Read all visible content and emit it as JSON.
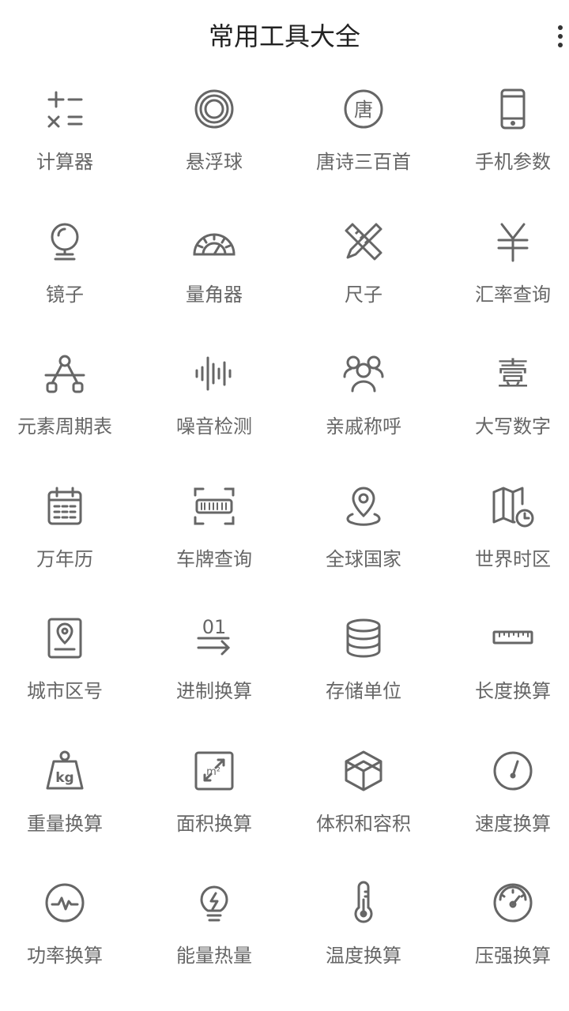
{
  "header": {
    "title": "常用工具大全"
  },
  "tools": [
    {
      "label": "计算器",
      "icon": "calculator-icon"
    },
    {
      "label": "悬浮球",
      "icon": "floating-ball-icon"
    },
    {
      "label": "唐诗三百首",
      "icon": "tang-poetry-icon",
      "icon_text": "唐"
    },
    {
      "label": "手机参数",
      "icon": "phone-icon"
    },
    {
      "label": "镜子",
      "icon": "mirror-icon"
    },
    {
      "label": "量角器",
      "icon": "protractor-icon"
    },
    {
      "label": "尺子",
      "icon": "ruler-pencil-icon"
    },
    {
      "label": "汇率查询",
      "icon": "yen-icon"
    },
    {
      "label": "元素周期表",
      "icon": "element-nodes-icon"
    },
    {
      "label": "噪音检测",
      "icon": "sound-wave-icon"
    },
    {
      "label": "亲戚称呼",
      "icon": "family-icon"
    },
    {
      "label": "大写数字",
      "icon": "chinese-numeral-icon",
      "icon_text": "壹"
    },
    {
      "label": "万年历",
      "icon": "calendar-icon"
    },
    {
      "label": "车牌查询",
      "icon": "license-plate-icon"
    },
    {
      "label": "全球国家",
      "icon": "location-pin-icon"
    },
    {
      "label": "世界时区",
      "icon": "map-clock-icon"
    },
    {
      "label": "城市区号",
      "icon": "city-pin-card-icon"
    },
    {
      "label": "进制换算",
      "icon": "binary-arrow-icon",
      "icon_text": "01"
    },
    {
      "label": "存储单位",
      "icon": "database-icon"
    },
    {
      "label": "长度换算",
      "icon": "ruler-icon"
    },
    {
      "label": "重量换算",
      "icon": "weight-kg-icon",
      "icon_text": "kg"
    },
    {
      "label": "面积换算",
      "icon": "area-icon",
      "icon_text": "m²"
    },
    {
      "label": "体积和容积",
      "icon": "cube-icon"
    },
    {
      "label": "速度换算",
      "icon": "speedometer-icon"
    },
    {
      "label": "功率换算",
      "icon": "power-pulse-icon"
    },
    {
      "label": "能量热量",
      "icon": "energy-bulb-icon"
    },
    {
      "label": "温度换算",
      "icon": "thermometer-icon"
    },
    {
      "label": "压强换算",
      "icon": "pressure-gauge-icon"
    }
  ]
}
